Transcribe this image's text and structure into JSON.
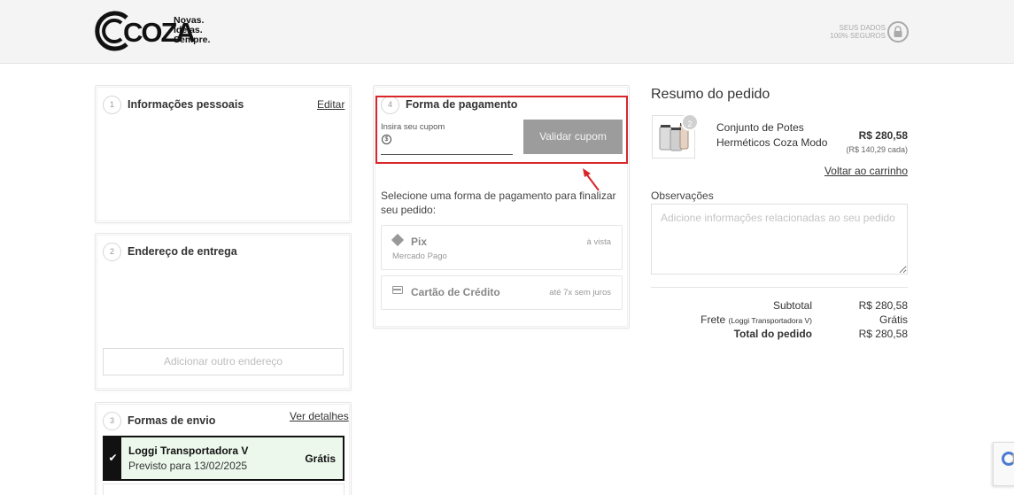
{
  "header": {
    "brand": "COZA",
    "tagline": [
      "Novas.",
      "Ideias.",
      "Sempre."
    ],
    "secure_text": [
      "SEUS DADOS",
      "100% SEGUROS"
    ]
  },
  "steps": {
    "personal": {
      "number": "1",
      "title": "Informações pessoais",
      "edit_label": "Editar"
    },
    "address": {
      "number": "2",
      "title": "Endereço de entrega",
      "add_label": "Adicionar outro endereço"
    },
    "shipping": {
      "number": "3",
      "title": "Formas de envio",
      "details_label": "Ver detalhes",
      "selected_option": {
        "name": "Loggi Transportadora V",
        "estimate": "Previsto para 13/02/2025",
        "price": "Grátis"
      }
    },
    "payment": {
      "number": "4",
      "title": "Forma de pagamento",
      "coupon_label": "Insira seu cupom",
      "coupon_value": "",
      "coupon_button": "Validar cupom",
      "instructions": "Selecione uma forma de pagamento para finalizar seu pedido:",
      "options": [
        {
          "name": "Pix",
          "sub": "Mercado Pago",
          "note": "à vista",
          "icon": "pix-icon"
        },
        {
          "name": "Cartão de Crédito",
          "sub": "",
          "note": "até 7x sem juros",
          "icon": "credit-card-icon"
        }
      ]
    }
  },
  "summary": {
    "title": "Resumo do pedido",
    "product": {
      "quantity": "2",
      "name": "Conjunto de Potes Herméticos Coza Modo",
      "price": "R$ 280,58",
      "unit_price": "(R$ 140,29 cada)"
    },
    "back_link": "Voltar ao carrinho",
    "observations_label": "Observações",
    "observations_placeholder": "Adicione informações relacionadas ao seu pedido",
    "subtotal_label": "Subtotal",
    "subtotal_value": "R$ 280,58",
    "shipping_label": "Frete",
    "shipping_carrier": "(Loggi Transportadora V)",
    "shipping_value": "Grátis",
    "total_label": "Total do pedido",
    "total_value": "R$ 280,58"
  },
  "colors": {
    "highlight": "#d9262b",
    "button_disabled": "#9c9c9c",
    "selected_bg": "#ecf8ec"
  }
}
